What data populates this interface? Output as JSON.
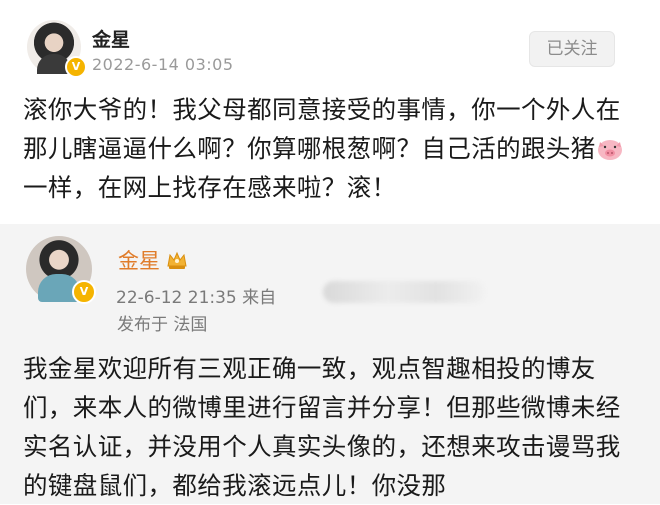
{
  "post": {
    "author": "金星",
    "timestamp": "2022-6-14 03:05",
    "follow_label": "已关注",
    "text_part1": "滚你大爷的！我父母都同意接受的事情，你一个外人在那儿瞎逼逼什么啊？你算哪根葱啊？自己活的跟头猪",
    "text_part2": "一样，在网上找存在感来啦？滚！",
    "pig_icon": "pig-emoji-icon"
  },
  "quoted_post": {
    "author": "金星",
    "timestamp": "22-6-12 21:35",
    "source_prefix": "来自",
    "location": "发布于 法国",
    "text": "我金星欢迎所有三观正确一致，观点智趣相投的博友们，来本人的微博里进行留言并分享！但那些微博未经实名认证，并没用个人真实头像的，还想来攻击谩骂我的键盘鼠们，都给我滚远点儿！你没那"
  },
  "colors": {
    "quoted_name": "#e07c2a",
    "verified_badge": "#f5b400",
    "quote_background": "#f4f4f4"
  }
}
